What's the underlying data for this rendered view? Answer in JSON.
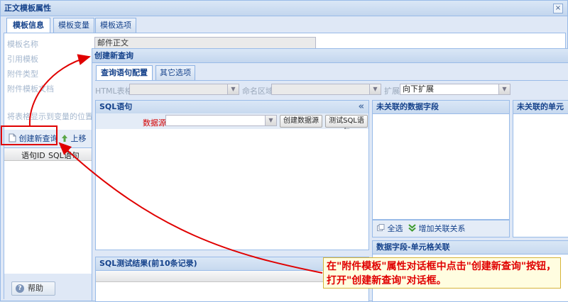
{
  "outer": {
    "title": "正文模板属性",
    "close_glyph": "×",
    "tabs": [
      "模板信息",
      "模板变量",
      "模板选项"
    ],
    "labels": [
      "模板名称",
      "引用模板",
      "附件类型",
      "附件模板文档",
      "将表格显示到变量的位置上"
    ],
    "name_value": "邮件正文",
    "toolbar": {
      "create_query": "创建新查询",
      "move_up": "上移"
    },
    "grid_headers": [
      "语句ID",
      "SQL语句"
    ],
    "help": "帮助"
  },
  "inner": {
    "title": "创建新查询",
    "tabs": [
      "查询语句配置",
      "其它选项"
    ],
    "filter": {
      "html_table_label": "HTML表格",
      "named_region_label": "命名区域",
      "expand_label": "扩展",
      "expand_value": "向下扩展"
    },
    "sql_panel": {
      "title": "SQL语句",
      "collapse_glyph": "«",
      "datasource_label": "数据源",
      "create_ds": "创建数据源",
      "test_sql": "测试SQL语句"
    },
    "unlinked_fields": {
      "title": "未关联的数据字段",
      "select_all": "全选",
      "add_link": "增加关联关系"
    },
    "unlinked_cells": {
      "title": "未关联的单元格"
    },
    "link_panel": {
      "title": "数据字段-单元格关联"
    },
    "result_panel": {
      "title": "SQL测试结果(前10条记录)"
    }
  },
  "annotation": {
    "text": "在\"附件模板\"属性对话框中点击\"创建新查询\"按钮，打开\"创建新查询\"对话框。",
    "color": "#e00000"
  }
}
